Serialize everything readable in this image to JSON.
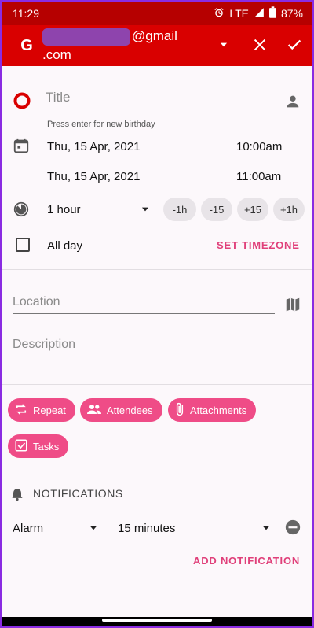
{
  "status_bar": {
    "time": "11:29",
    "network": "LTE",
    "battery": "87%"
  },
  "app_bar": {
    "account_suffix": "@gmail",
    "account_line2": ".com"
  },
  "event": {
    "title_placeholder": "Title",
    "hint": "Press enter for new birthday",
    "start_date": "Thu, 15 Apr, 2021",
    "start_time": "10:00am",
    "end_date": "Thu, 15 Apr, 2021",
    "end_time": "11:00am",
    "duration": "1 hour",
    "quick_adjust": [
      "-1h",
      "-15",
      "+15",
      "+1h"
    ],
    "all_day_label": "All day",
    "set_timezone": "SET TIMEZONE",
    "location_placeholder": "Location",
    "description_placeholder": "Description"
  },
  "actions": {
    "repeat": "Repeat",
    "attendees": "Attendees",
    "attachments": "Attachments",
    "tasks": "Tasks"
  },
  "notifications": {
    "header": "NOTIFICATIONS",
    "type": "Alarm",
    "interval": "15 minutes",
    "add_label": "ADD NOTIFICATION"
  },
  "colors": {
    "status_bar": "#b60000",
    "app_bar": "#d90000",
    "accent": "#e0407a",
    "pill": "#ef4c87"
  }
}
